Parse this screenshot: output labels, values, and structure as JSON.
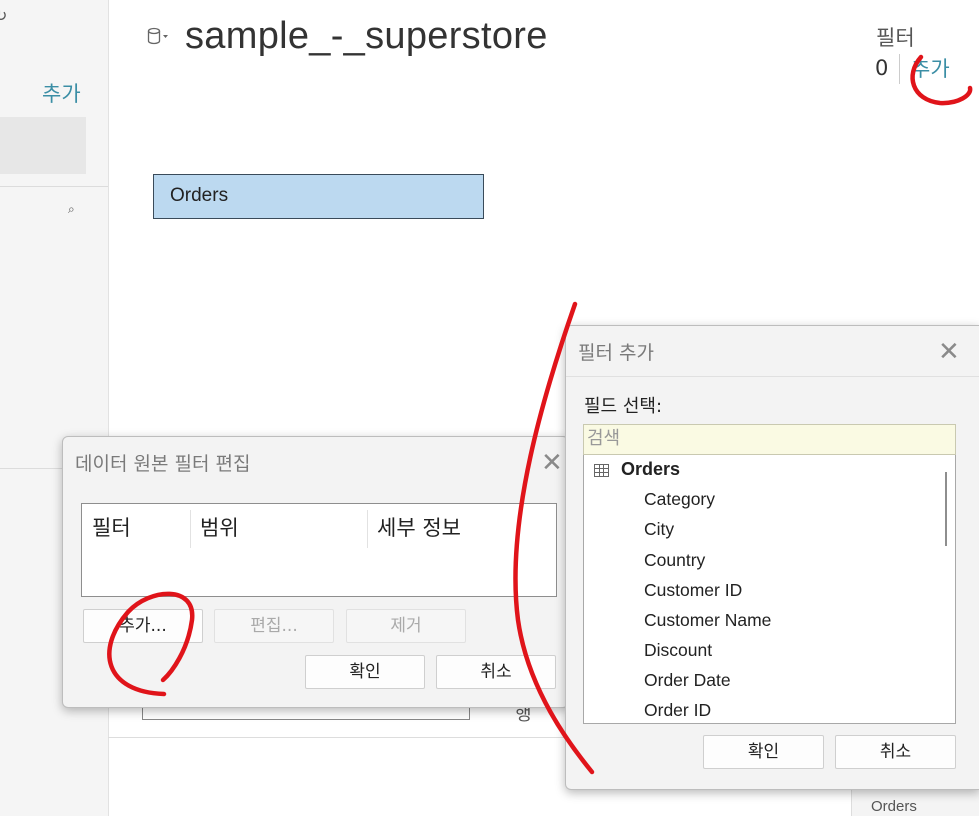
{
  "left_pane": {
    "add_label": "추가"
  },
  "header": {
    "datasource_title": "sample_-_superstore",
    "filter_title": "필터",
    "filter_count": "0",
    "filter_add": "추가"
  },
  "canvas": {
    "table_name": "Orders"
  },
  "background_partial": {
    "row_label": "행",
    "bottom_orders": "Orders"
  },
  "edit_filter_dialog": {
    "title": "데이터 원본 필터 편집",
    "columns": [
      "필터",
      "범위",
      "세부 정보"
    ],
    "buttons": {
      "add": "추가...",
      "edit": "편집...",
      "remove": "제거",
      "ok": "확인",
      "cancel": "취소"
    }
  },
  "add_filter_dialog": {
    "title": "필터 추가",
    "field_select_label": "필드 선택:",
    "search_placeholder": "검색",
    "root": "Orders",
    "fields": [
      "Category",
      "City",
      "Country",
      "Customer ID",
      "Customer Name",
      "Discount",
      "Order Date",
      "Order ID"
    ],
    "buttons": {
      "ok": "확인",
      "cancel": "취소"
    }
  },
  "colors": {
    "accent": "#3b8ea5",
    "table_fill": "#bcd9f0",
    "annotation": "#e0141a"
  }
}
